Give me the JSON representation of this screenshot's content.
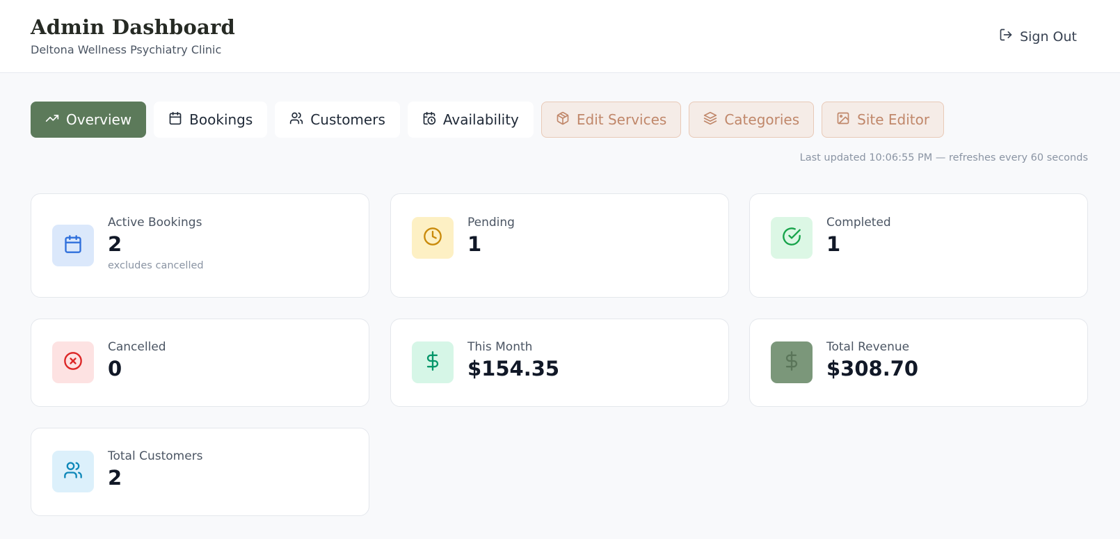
{
  "header": {
    "title": "Admin Dashboard",
    "subtitle": "Deltona Wellness Psychiatry Clinic",
    "sign_out_label": "Sign Out"
  },
  "tabs": [
    {
      "label": "Overview",
      "icon": "trending-up-icon",
      "state": "active"
    },
    {
      "label": "Bookings",
      "icon": "calendar-icon",
      "state": "default"
    },
    {
      "label": "Customers",
      "icon": "users-icon",
      "state": "default"
    },
    {
      "label": "Availability",
      "icon": "calendar-clock-icon",
      "state": "default"
    },
    {
      "label": "Edit Services",
      "icon": "package-icon",
      "state": "admin"
    },
    {
      "label": "Categories",
      "icon": "layers-icon",
      "state": "admin"
    },
    {
      "label": "Site Editor",
      "icon": "image-icon",
      "state": "admin"
    }
  ],
  "last_updated": "Last updated 10:06:55 PM — refreshes every 60 seconds",
  "stats": {
    "active_bookings": {
      "label": "Active Bookings",
      "value": "2",
      "note": "excludes cancelled",
      "icon": "calendar-icon"
    },
    "pending": {
      "label": "Pending",
      "value": "1",
      "icon": "clock-icon"
    },
    "completed": {
      "label": "Completed",
      "value": "1",
      "icon": "check-circle-icon"
    },
    "cancelled": {
      "label": "Cancelled",
      "value": "0",
      "icon": "x-circle-icon"
    },
    "this_month": {
      "label": "This Month",
      "value": "$154.35",
      "icon": "dollar-icon"
    },
    "total_revenue": {
      "label": "Total Revenue",
      "value": "$308.70",
      "icon": "dollar-icon"
    },
    "total_customers": {
      "label": "Total Customers",
      "value": "2",
      "icon": "users-icon"
    }
  },
  "colors": {
    "accent": "#5c7a5a",
    "admin_tab_bg": "#f5ece7",
    "admin_tab_text": "#c0876a",
    "blue_tint": "#dbe8fb",
    "amber_tint": "#fdf0c4",
    "green_tint": "#dcf7e5",
    "red_tint": "#fde2e2",
    "emerald_tint": "#d6f6e7",
    "sage": "#7b977a",
    "sky_tint": "#dcf0fb"
  }
}
